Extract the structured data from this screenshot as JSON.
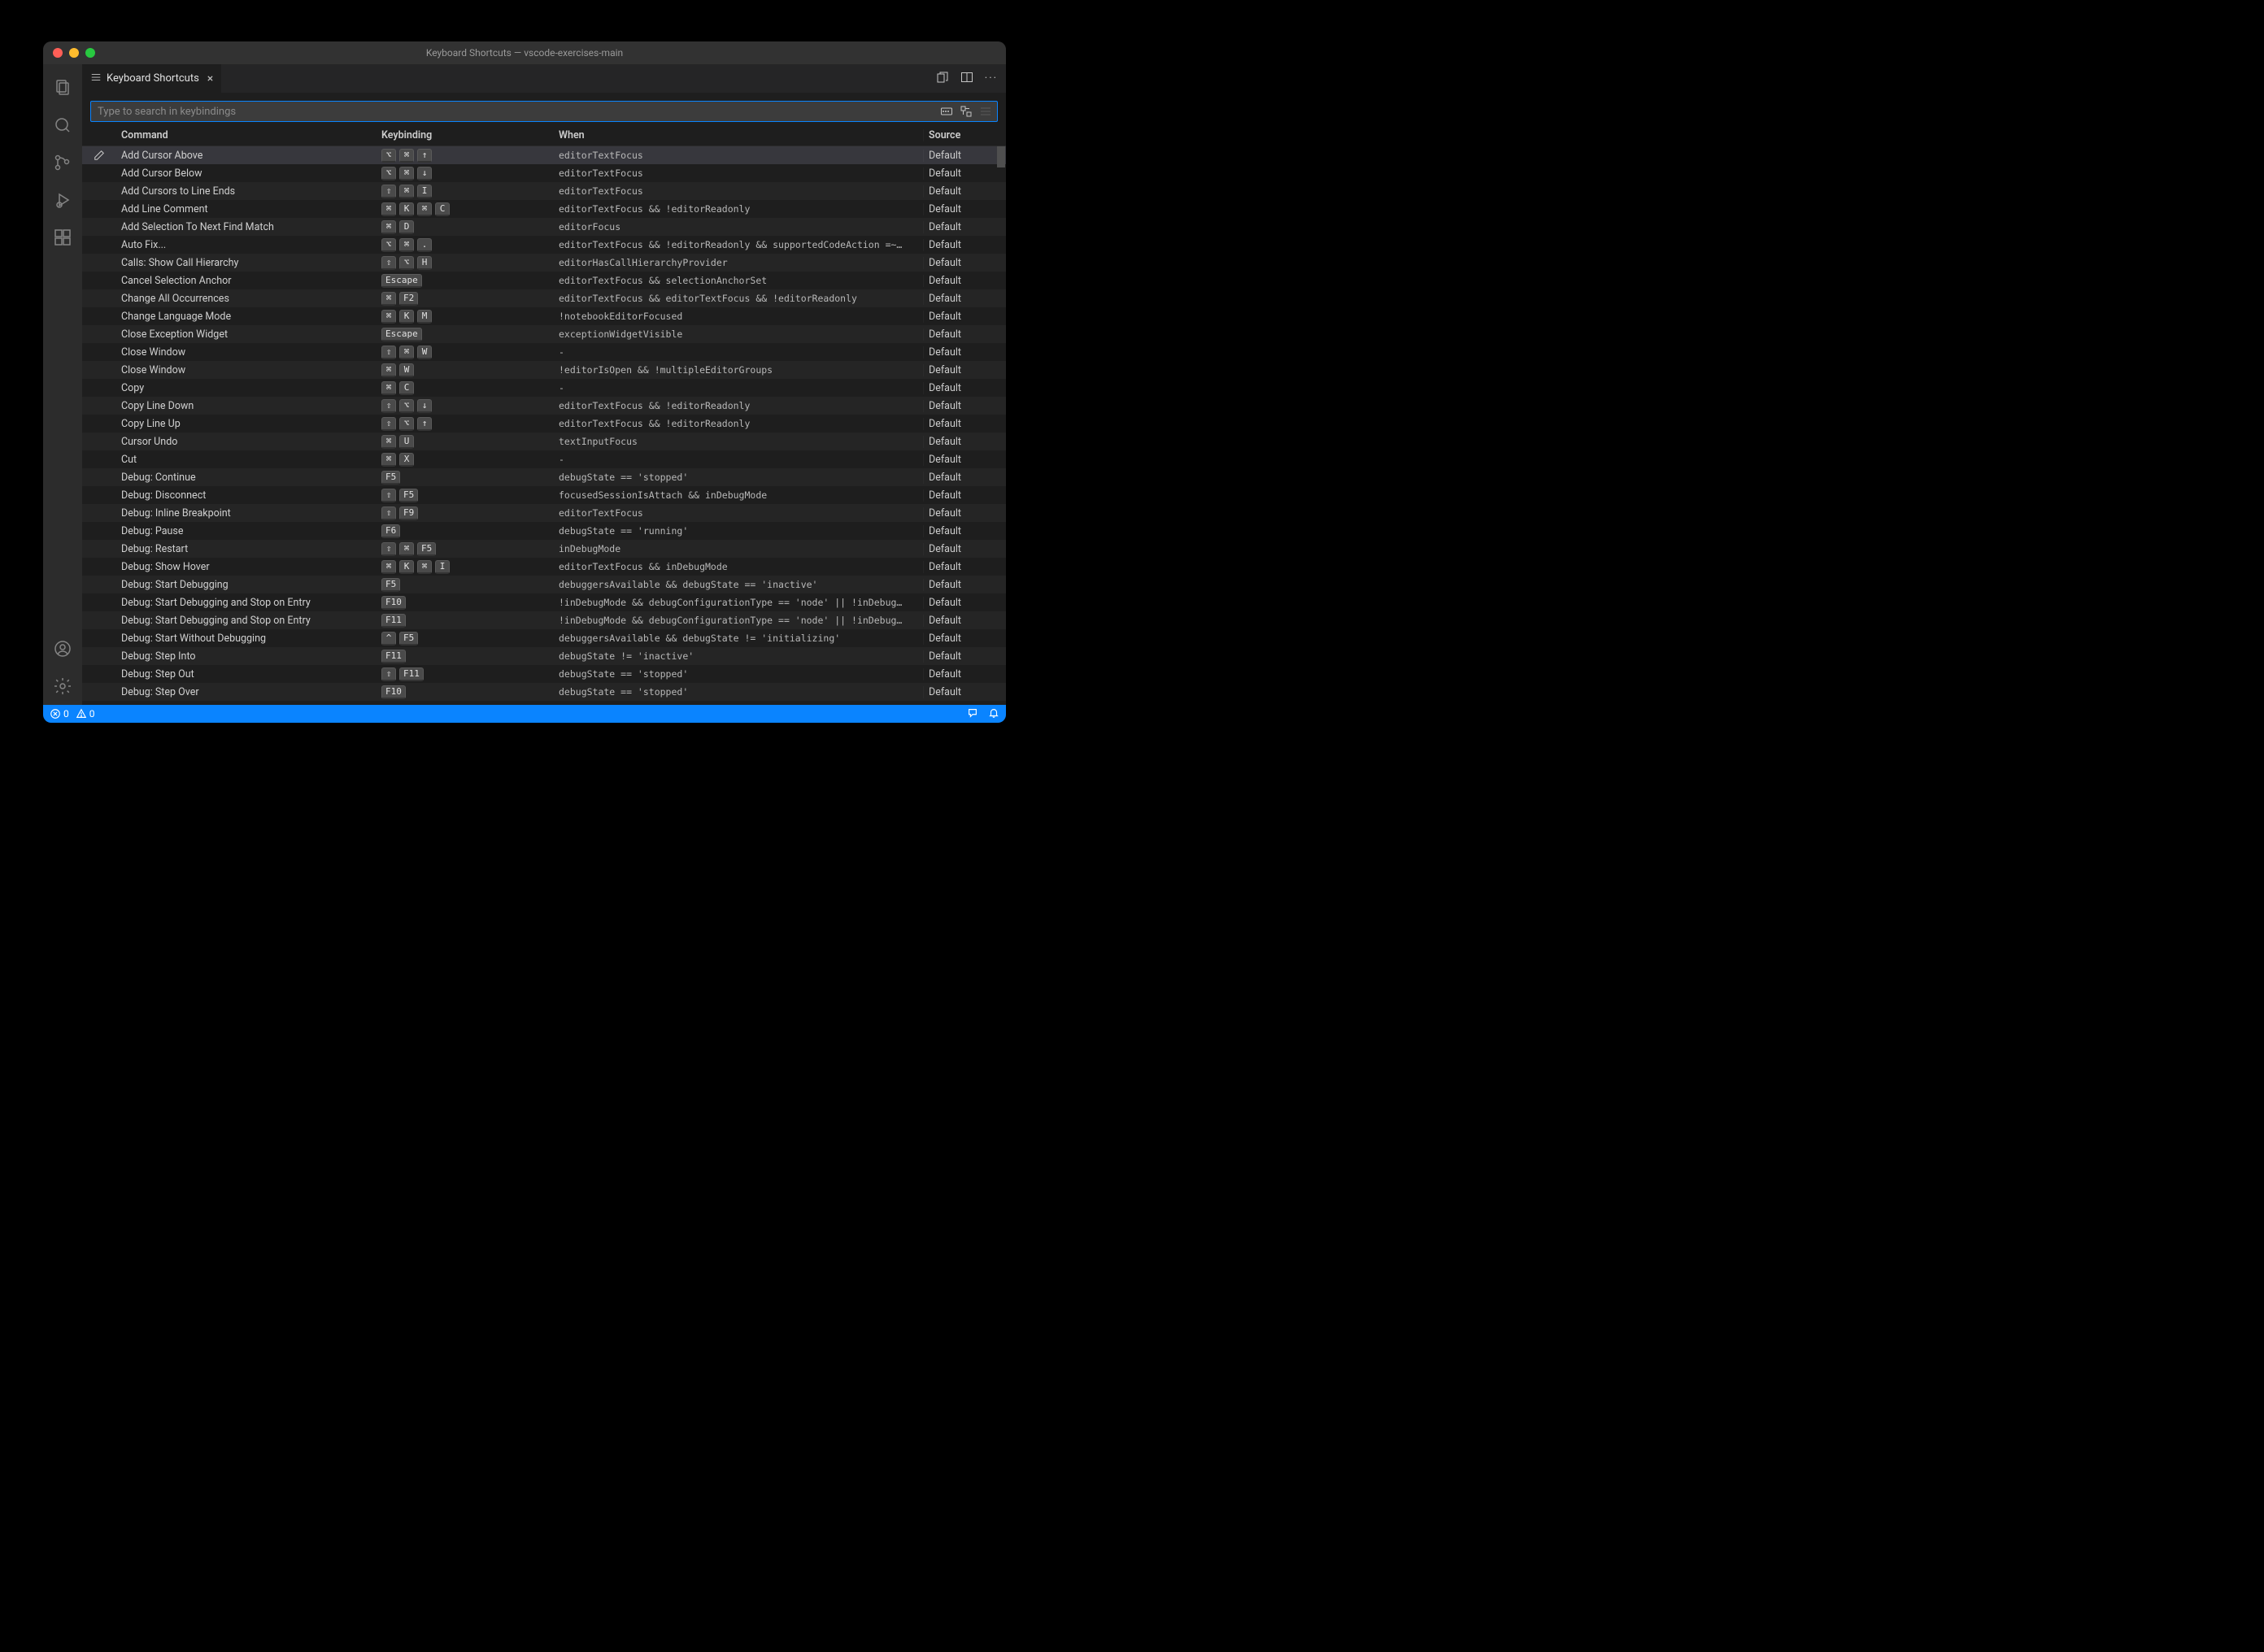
{
  "window_title": "Keyboard Shortcuts — vscode-exercises-main",
  "tab": {
    "label": "Keyboard Shortcuts"
  },
  "search": {
    "placeholder": "Type to search in keybindings"
  },
  "columns": {
    "command": "Command",
    "keybinding": "Keybinding",
    "when": "When",
    "source": "Source"
  },
  "rows": [
    {
      "command": "Add Cursor Above",
      "keys": [
        "⌥",
        "⌘",
        "↑"
      ],
      "when": "editorTextFocus",
      "source": "Default",
      "selected": true,
      "edit": true
    },
    {
      "command": "Add Cursor Below",
      "keys": [
        "⌥",
        "⌘",
        "↓"
      ],
      "when": "editorTextFocus",
      "source": "Default"
    },
    {
      "command": "Add Cursors to Line Ends",
      "keys": [
        "⇧",
        "⌘",
        "I"
      ],
      "when": "editorTextFocus",
      "source": "Default"
    },
    {
      "command": "Add Line Comment",
      "keys": [
        "⌘",
        "K",
        "⌘",
        "C"
      ],
      "when": "editorTextFocus && !editorReadonly",
      "source": "Default"
    },
    {
      "command": "Add Selection To Next Find Match",
      "keys": [
        "⌘",
        "D"
      ],
      "when": "editorFocus",
      "source": "Default"
    },
    {
      "command": "Auto Fix...",
      "keys": [
        "⌥",
        "⌘",
        "."
      ],
      "when": "editorTextFocus && !editorReadonly && supportedCodeAction =~…",
      "source": "Default"
    },
    {
      "command": "Calls: Show Call Hierarchy",
      "keys": [
        "⇧",
        "⌥",
        "H"
      ],
      "when": "editorHasCallHierarchyProvider",
      "source": "Default"
    },
    {
      "command": "Cancel Selection Anchor",
      "keys": [
        "Escape"
      ],
      "when": "editorTextFocus && selectionAnchorSet",
      "source": "Default"
    },
    {
      "command": "Change All Occurrences",
      "keys": [
        "⌘",
        "F2"
      ],
      "when": "editorTextFocus && editorTextFocus && !editorReadonly",
      "source": "Default"
    },
    {
      "command": "Change Language Mode",
      "keys": [
        "⌘",
        "K",
        "M"
      ],
      "when": "!notebookEditorFocused",
      "source": "Default"
    },
    {
      "command": "Close Exception Widget",
      "keys": [
        "Escape"
      ],
      "when": "exceptionWidgetVisible",
      "source": "Default"
    },
    {
      "command": "Close Window",
      "keys": [
        "⇧",
        "⌘",
        "W"
      ],
      "when": "-",
      "source": "Default"
    },
    {
      "command": "Close Window",
      "keys": [
        "⌘",
        "W"
      ],
      "when": "!editorIsOpen && !multipleEditorGroups",
      "source": "Default"
    },
    {
      "command": "Copy",
      "keys": [
        "⌘",
        "C"
      ],
      "when": "-",
      "source": "Default"
    },
    {
      "command": "Copy Line Down",
      "keys": [
        "⇧",
        "⌥",
        "↓"
      ],
      "when": "editorTextFocus && !editorReadonly",
      "source": "Default"
    },
    {
      "command": "Copy Line Up",
      "keys": [
        "⇧",
        "⌥",
        "↑"
      ],
      "when": "editorTextFocus && !editorReadonly",
      "source": "Default"
    },
    {
      "command": "Cursor Undo",
      "keys": [
        "⌘",
        "U"
      ],
      "when": "textInputFocus",
      "source": "Default"
    },
    {
      "command": "Cut",
      "keys": [
        "⌘",
        "X"
      ],
      "when": "-",
      "source": "Default"
    },
    {
      "command": "Debug: Continue",
      "keys": [
        "F5"
      ],
      "when": "debugState == 'stopped'",
      "source": "Default"
    },
    {
      "command": "Debug: Disconnect",
      "keys": [
        "⇧",
        "F5"
      ],
      "when": "focusedSessionIsAttach && inDebugMode",
      "source": "Default"
    },
    {
      "command": "Debug: Inline Breakpoint",
      "keys": [
        "⇧",
        "F9"
      ],
      "when": "editorTextFocus",
      "source": "Default"
    },
    {
      "command": "Debug: Pause",
      "keys": [
        "F6"
      ],
      "when": "debugState == 'running'",
      "source": "Default"
    },
    {
      "command": "Debug: Restart",
      "keys": [
        "⇧",
        "⌘",
        "F5"
      ],
      "when": "inDebugMode",
      "source": "Default"
    },
    {
      "command": "Debug: Show Hover",
      "keys": [
        "⌘",
        "K",
        "⌘",
        "I"
      ],
      "when": "editorTextFocus && inDebugMode",
      "source": "Default"
    },
    {
      "command": "Debug: Start Debugging",
      "keys": [
        "F5"
      ],
      "when": "debuggersAvailable && debugState == 'inactive'",
      "source": "Default"
    },
    {
      "command": "Debug: Start Debugging and Stop on Entry",
      "keys": [
        "F10"
      ],
      "when": "!inDebugMode && debugConfigurationType == 'node' || !inDebug…",
      "source": "Default"
    },
    {
      "command": "Debug: Start Debugging and Stop on Entry",
      "keys": [
        "F11"
      ],
      "when": "!inDebugMode && debugConfigurationType == 'node' || !inDebug…",
      "source": "Default"
    },
    {
      "command": "Debug: Start Without Debugging",
      "keys": [
        "^",
        "F5"
      ],
      "when": "debuggersAvailable && debugState != 'initializing'",
      "source": "Default"
    },
    {
      "command": "Debug: Step Into",
      "keys": [
        "F11"
      ],
      "when": "debugState != 'inactive'",
      "source": "Default"
    },
    {
      "command": "Debug: Step Out",
      "keys": [
        "⇧",
        "F11"
      ],
      "when": "debugState == 'stopped'",
      "source": "Default"
    },
    {
      "command": "Debug: Step Over",
      "keys": [
        "F10"
      ],
      "when": "debugState == 'stopped'",
      "source": "Default"
    }
  ],
  "statusbar": {
    "errors": "0",
    "warnings": "0"
  }
}
